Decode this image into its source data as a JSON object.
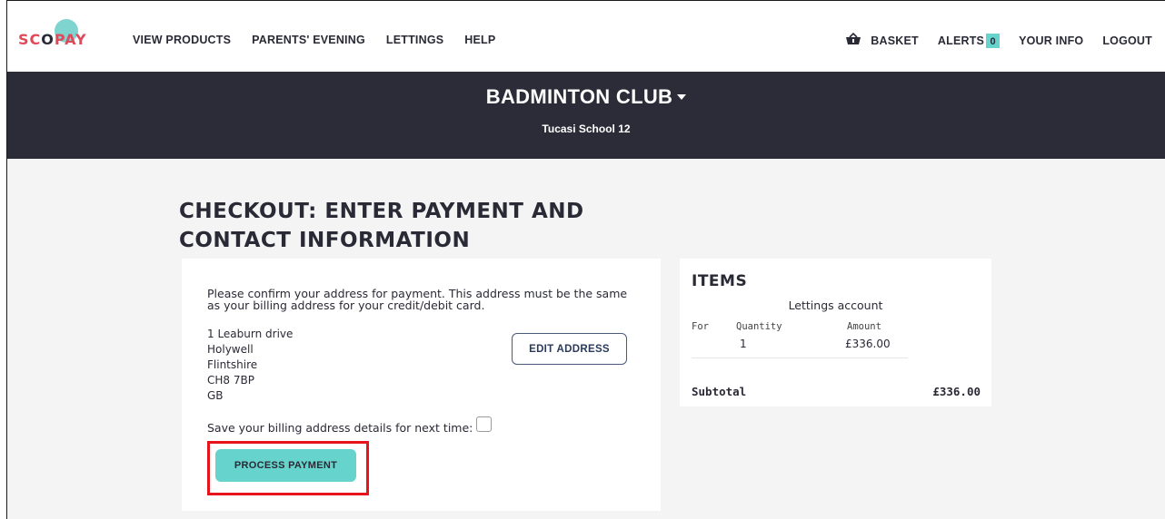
{
  "brand": {
    "logo_text_a": "SC",
    "logo_text_o": "O",
    "logo_text_b": "PAY"
  },
  "nav": {
    "left": [
      "VIEW PRODUCTS",
      "PARENTS' EVENING",
      "LETTINGS",
      "HELP"
    ],
    "basket": "BASKET",
    "alerts": "ALERTS",
    "alerts_count": "0",
    "your_info": "YOUR INFO",
    "logout": "LOGOUT"
  },
  "banner": {
    "title": "BADMINTON CLUB",
    "subtitle": "Tucasi School 12"
  },
  "page": {
    "title": "CHECKOUT: ENTER PAYMENT AND CONTACT INFORMATION"
  },
  "payment": {
    "confirm_text": "Please confirm your address for payment. This address must be the same as your billing address for your credit/debit card.",
    "address": [
      "1 Leaburn drive",
      "Holywell",
      "Flintshire",
      "CH8 7BP",
      "GB"
    ],
    "edit_address_label": "EDIT ADDRESS",
    "save_billing_label": "Save your billing address details for next time:",
    "save_billing_checked": false,
    "process_payment_label": "PROCESS PAYMENT"
  },
  "items": {
    "title": "ITEMS",
    "item_name": "Lettings account",
    "col_for": "For",
    "col_quantity": "Quantity",
    "col_amount": "Amount",
    "quantity": "1",
    "amount": "£336.00",
    "subtotal_label": "Subtotal",
    "subtotal_value": "£336.00"
  },
  "colors": {
    "accent": "#66d4cc",
    "banner": "#2c2c38",
    "highlight": "#e8141c",
    "brand_red": "#e0495a"
  }
}
